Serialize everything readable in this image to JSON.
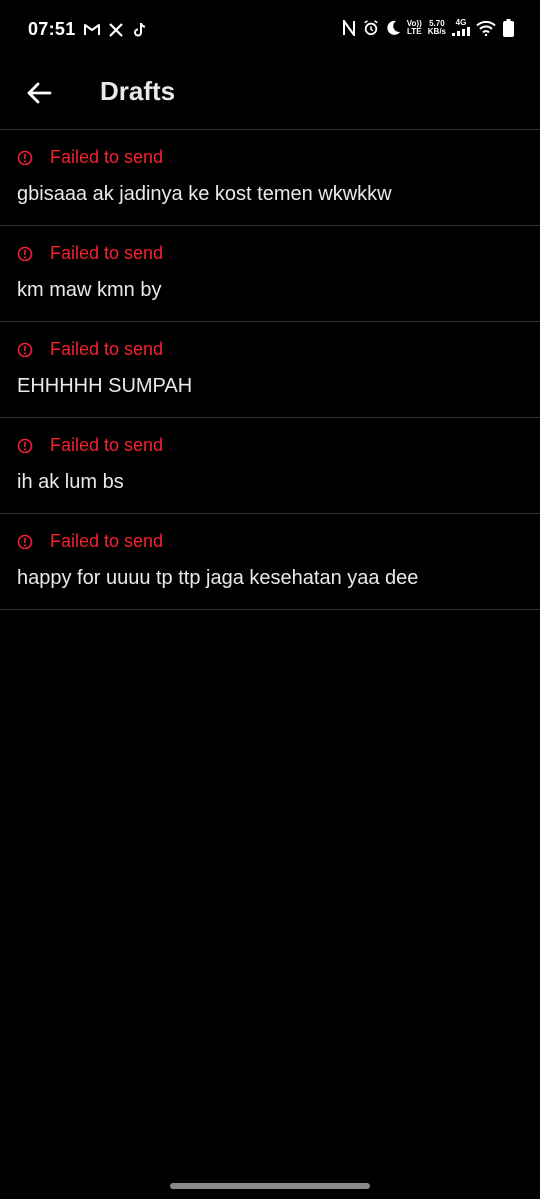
{
  "status_bar": {
    "time": "07:51",
    "left_icons": [
      "gmail-icon",
      "x-icon",
      "tiktok-icon"
    ],
    "right_icons": [
      "nfc-icon",
      "alarm-icon",
      "do-not-disturb-moon-icon",
      "volte-icon",
      "network-speed",
      "signal-4g-icon",
      "wifi-icon",
      "battery-icon"
    ],
    "volte_top": "Vo))",
    "volte_bottom": "LTE",
    "speed_value": "5.70",
    "speed_unit": "KB/s",
    "network_type": "4G"
  },
  "header": {
    "back_icon": "arrow-left-icon",
    "title": "Drafts"
  },
  "drafts": [
    {
      "status": "Failed to send",
      "text": "gbisaaa ak jadinya ke kost temen wkwkkw"
    },
    {
      "status": "Failed to send",
      "text": "km maw kmn by"
    },
    {
      "status": "Failed to send",
      "text": "EHHHHH SUMPAH"
    },
    {
      "status": "Failed to send",
      "text": "ih ak lum bs"
    },
    {
      "status": "Failed to send",
      "text": "happy for uuuu tp ttp jaga kesehatan yaa dee"
    }
  ],
  "colors": {
    "background": "#000000",
    "text": "#e7e9ea",
    "error": "#f4212e",
    "divider": "#2f3336"
  }
}
